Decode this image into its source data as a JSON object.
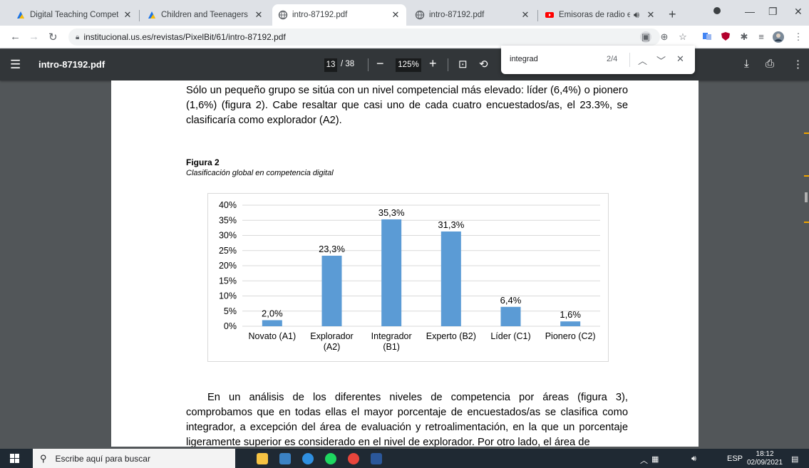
{
  "browser": {
    "tabs": [
      {
        "title": "Digital Teaching Competence",
        "active": false
      },
      {
        "title": "Children and Teenagers and C",
        "active": false
      },
      {
        "title": "intro-87192.pdf",
        "active": true
      },
      {
        "title": "intro-87192.pdf",
        "active": false
      },
      {
        "title": "Emisoras de radio españ",
        "active": false
      }
    ],
    "url": "institucional.us.es/revistas/PixelBit/61/intro-87192.pdf"
  },
  "pdf_toolbar": {
    "filename": "intro-87192.pdf",
    "current_page": "13",
    "total_pages": "/ 38",
    "zoom": "125%"
  },
  "find_bar": {
    "query": "integrad",
    "match_count": "2/4"
  },
  "document": {
    "paragraph1": "Sólo un pequeño grupo se sitúa con un nivel competencial más elevado: líder (6,4%) o pionero (1,6%) (figura 2). Cabe resaltar que casi uno de cada cuatro encuestados/as, el 23.3%, se clasificaría como explorador (A2).",
    "figure_title": "Figura 2",
    "figure_caption": "Clasificación global en competencia digital",
    "paragraph2": "En un análisis de los diferentes niveles de competencia por áreas (figura 3), comprobamos que en todas ellas el mayor porcentaje de encuestados/as se clasifica como integrador, a excepción del área de evaluación y retroalimentación, en la que un porcentaje ligeramente superior es considerado en el nivel de explorador. Por otro lado, el área de"
  },
  "chart_data": {
    "type": "bar",
    "categories": [
      [
        "Novato (A1)"
      ],
      [
        "Explorador",
        "(A2)"
      ],
      [
        "Integrador",
        "(B1)"
      ],
      [
        "Experto (B2)"
      ],
      [
        "Líder (C1)"
      ],
      [
        "Pionero (C2)"
      ]
    ],
    "values": [
      2.0,
      23.3,
      35.3,
      31.3,
      6.4,
      1.6
    ],
    "data_labels": [
      "2,0%",
      "23,3%",
      "35,3%",
      "31,3%",
      "6,4%",
      "1,6%"
    ],
    "y_ticks": [
      "0%",
      "5%",
      "10%",
      "15%",
      "20%",
      "25%",
      "30%",
      "35%",
      "40%"
    ],
    "ylim": [
      0,
      40
    ],
    "grid": true,
    "bar_color": "#5b9bd5"
  },
  "taskbar": {
    "search_placeholder": "Escribe aquí para buscar",
    "language": "ESP",
    "time": "18:12",
    "date": "02/09/2021"
  },
  "colors": {
    "pdf_toolbar_bg": "#323639",
    "viewer_bg": "#525659",
    "tab_strip_bg": "#dee1e6"
  }
}
